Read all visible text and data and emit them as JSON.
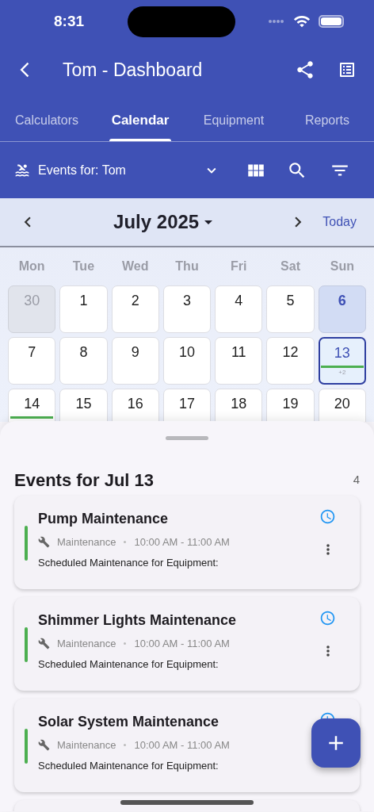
{
  "status_bar": {
    "time": "8:31"
  },
  "app_bar": {
    "title": "Tom - Dashboard"
  },
  "tabs": [
    {
      "label": "Calculators",
      "selected": false
    },
    {
      "label": "Calendar",
      "selected": true
    },
    {
      "label": "Equipment",
      "selected": false
    },
    {
      "label": "Reports",
      "selected": false
    }
  ],
  "filter": {
    "label": "Events for: Tom"
  },
  "calendar": {
    "month": "July 2025",
    "today_button": "Today",
    "weekdays": [
      "Mon",
      "Tue",
      "Wed",
      "Thu",
      "Fri",
      "Sat",
      "Sun"
    ],
    "days": [
      {
        "label": "30",
        "outside_month": true,
        "today": false,
        "selected": false,
        "has_event": false
      },
      {
        "label": "1",
        "outside_month": false,
        "today": false,
        "selected": false,
        "has_event": false
      },
      {
        "label": "2",
        "outside_month": false,
        "today": false,
        "selected": false,
        "has_event": false
      },
      {
        "label": "3",
        "outside_month": false,
        "today": false,
        "selected": false,
        "has_event": false
      },
      {
        "label": "4",
        "outside_month": false,
        "today": false,
        "selected": false,
        "has_event": false
      },
      {
        "label": "5",
        "outside_month": false,
        "today": false,
        "selected": false,
        "has_event": false
      },
      {
        "label": "6",
        "outside_month": false,
        "today": true,
        "selected": false,
        "has_event": false
      },
      {
        "label": "7",
        "outside_month": false,
        "today": false,
        "selected": false,
        "has_event": false
      },
      {
        "label": "8",
        "outside_month": false,
        "today": false,
        "selected": false,
        "has_event": false
      },
      {
        "label": "9",
        "outside_month": false,
        "today": false,
        "selected": false,
        "has_event": false
      },
      {
        "label": "10",
        "outside_month": false,
        "today": false,
        "selected": false,
        "has_event": false
      },
      {
        "label": "11",
        "outside_month": false,
        "today": false,
        "selected": false,
        "has_event": false
      },
      {
        "label": "12",
        "outside_month": false,
        "today": false,
        "selected": false,
        "has_event": false
      },
      {
        "label": "13",
        "outside_month": false,
        "today": false,
        "selected": true,
        "has_event": true,
        "more": "+2"
      },
      {
        "label": "14",
        "outside_month": false,
        "today": false,
        "selected": false,
        "has_event": true
      },
      {
        "label": "15",
        "outside_month": false,
        "today": false,
        "selected": false,
        "has_event": false
      },
      {
        "label": "16",
        "outside_month": false,
        "today": false,
        "selected": false,
        "has_event": false
      },
      {
        "label": "17",
        "outside_month": false,
        "today": false,
        "selected": false,
        "has_event": false
      },
      {
        "label": "18",
        "outside_month": false,
        "today": false,
        "selected": false,
        "has_event": false
      },
      {
        "label": "19",
        "outside_month": false,
        "today": false,
        "selected": false,
        "has_event": false
      },
      {
        "label": "20",
        "outside_month": false,
        "today": false,
        "selected": false,
        "has_event": false
      }
    ]
  },
  "events_panel": {
    "title": "Events for Jul 13",
    "count": "4",
    "events": [
      {
        "title": "Pump Maintenance",
        "category": "Maintenance",
        "time": "10:00 AM - 11:00 AM",
        "description": "Scheduled Maintenance for Equipment:",
        "color": "#4caf50"
      },
      {
        "title": "Shimmer Lights Maintenance",
        "category": "Maintenance",
        "time": "10:00 AM - 11:00 AM",
        "description": "Scheduled Maintenance for Equipment:",
        "color": "#4caf50"
      },
      {
        "title": "Solar System Maintenance",
        "category": "Maintenance",
        "time": "10:00 AM - 11:00 AM",
        "description": "Scheduled Maintenance for Equipment:",
        "color": "#4caf50"
      }
    ]
  }
}
